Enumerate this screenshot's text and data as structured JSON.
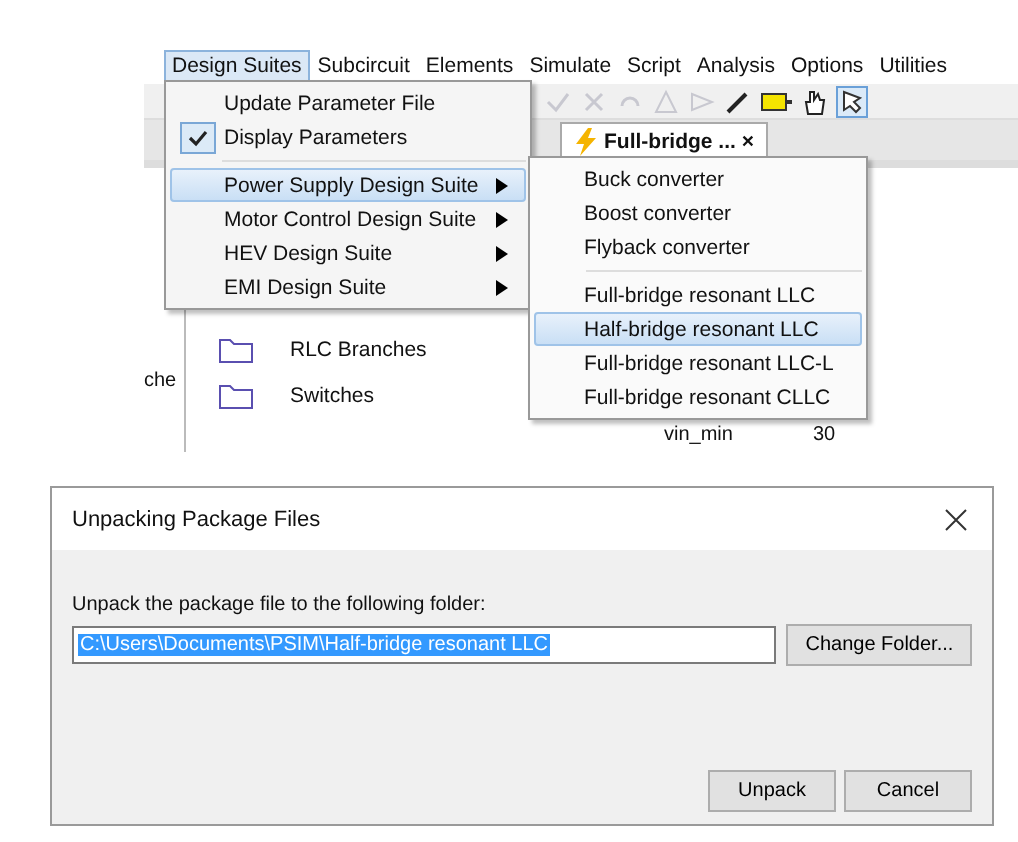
{
  "menu_bar": {
    "items": [
      {
        "label": "Design Suites",
        "selected": true
      },
      {
        "label": "Subcircuit",
        "selected": false
      },
      {
        "label": "Elements",
        "selected": false
      },
      {
        "label": "Simulate",
        "selected": false
      },
      {
        "label": "Script",
        "selected": false
      },
      {
        "label": "Analysis",
        "selected": false
      },
      {
        "label": "Options",
        "selected": false
      },
      {
        "label": "Utilities",
        "selected": false
      }
    ]
  },
  "document_tab": {
    "label": "Full-bridge ...",
    "close": "×"
  },
  "library_panel": {
    "cut_label": "che",
    "folders": [
      "RLC Branches",
      "Switches"
    ]
  },
  "parameter_table": {
    "cells": [
      "vin_min",
      "30"
    ]
  },
  "design_suites_menu": {
    "items": [
      {
        "kind": "command",
        "label": "Update Parameter File",
        "checked": false,
        "selected": false
      },
      {
        "kind": "command",
        "label": "Display Parameters",
        "checked": true,
        "selected": false
      },
      {
        "kind": "separator"
      },
      {
        "kind": "submenu",
        "label": "Power Supply Design Suite",
        "checked": false,
        "selected": true
      },
      {
        "kind": "submenu",
        "label": "Motor Control Design Suite",
        "checked": false,
        "selected": false
      },
      {
        "kind": "submenu",
        "label": "HEV Design Suite",
        "checked": false,
        "selected": false
      },
      {
        "kind": "submenu",
        "label": "EMI Design Suite",
        "checked": false,
        "selected": false
      }
    ]
  },
  "power_supply_submenu": {
    "items": [
      {
        "kind": "command",
        "label": "Buck converter",
        "selected": false
      },
      {
        "kind": "command",
        "label": "Boost converter",
        "selected": false
      },
      {
        "kind": "command",
        "label": "Flyback converter",
        "selected": false
      },
      {
        "kind": "separator"
      },
      {
        "kind": "command",
        "label": "Full-bridge resonant LLC",
        "selected": false
      },
      {
        "kind": "command",
        "label": "Half-bridge resonant LLC",
        "selected": true
      },
      {
        "kind": "command",
        "label": "Full-bridge resonant LLC-L",
        "selected": false
      },
      {
        "kind": "command",
        "label": "Full-bridge resonant CLLC",
        "selected": false
      }
    ]
  },
  "dialog": {
    "title": "Unpacking Package Files",
    "prompt": "Unpack the package file to the following folder:",
    "folder_path": "C:\\Users\\Documents\\PSIM\\Half-bridge resonant LLC",
    "path_selected": true,
    "change_folder_button": "Change Folder...",
    "buttons": [
      "Unpack",
      "Cancel"
    ]
  }
}
